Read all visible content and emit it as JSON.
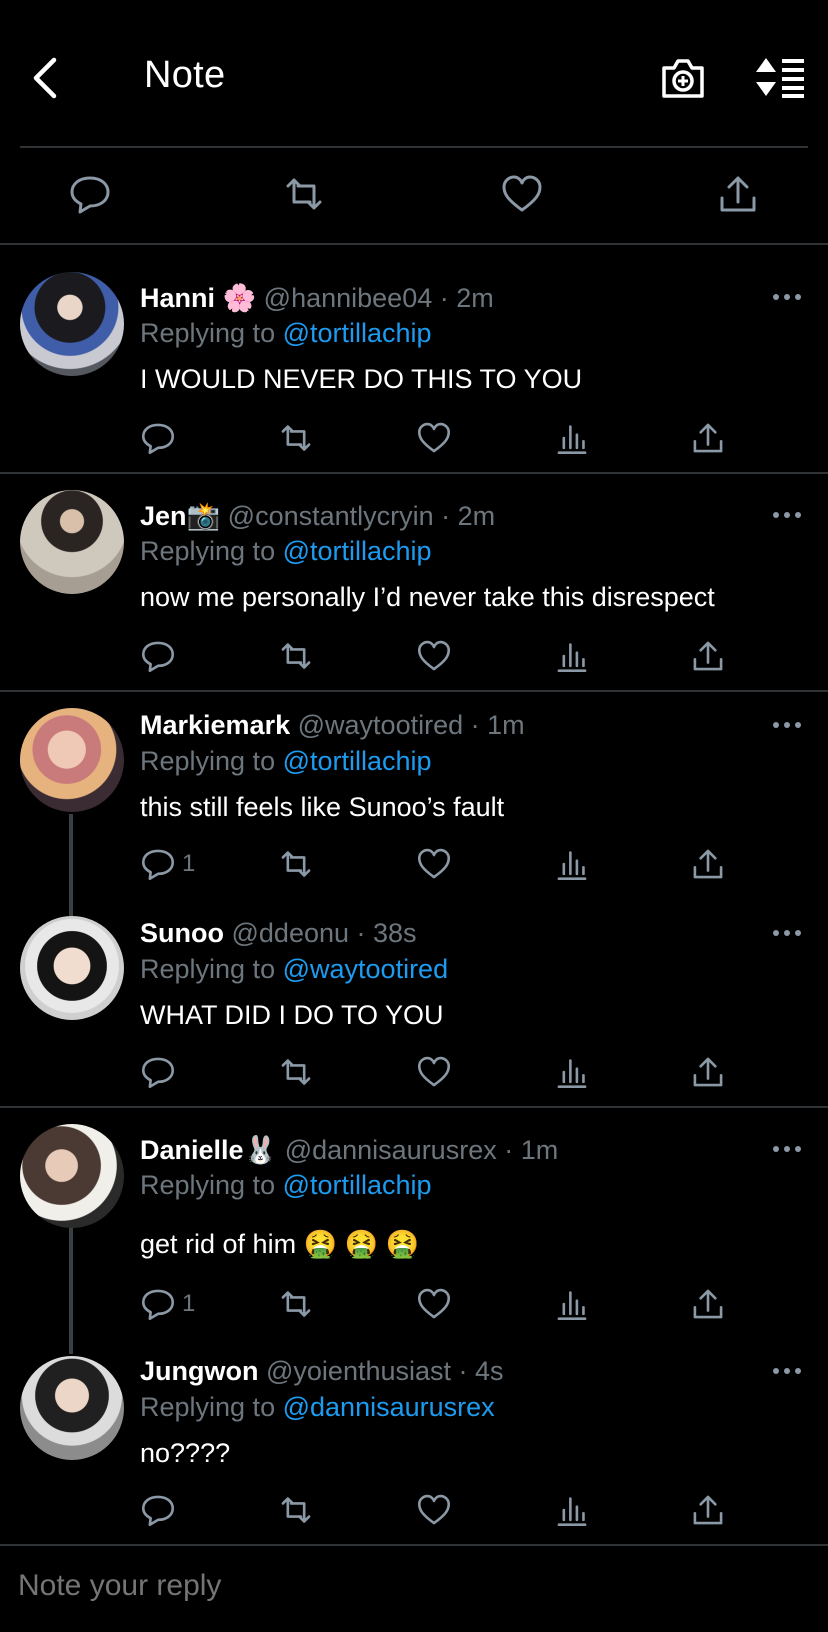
{
  "header": {
    "title": "Note",
    "back_icon": "chevron-left-icon",
    "camera_icon": "camera-plus-icon",
    "sort_icon": "sort-list-icon"
  },
  "action_bar": [
    "reply-icon",
    "retweet-icon",
    "like-icon",
    "share-icon"
  ],
  "colors": {
    "background": "#000000",
    "accent": "#1d9bf0",
    "muted": "#6e767d",
    "divider": "#2f3336"
  },
  "replying_label": "Replying to",
  "tweets": [
    {
      "name": "Hanni",
      "emoji": "🌸",
      "handle": "@hannibee04",
      "time": "· 2m",
      "replying_to": "@tortillachip",
      "text": "I WOULD NEVER DO THIS TO YOU",
      "reply_count": ""
    },
    {
      "name": "Jen",
      "emoji": "📸",
      "handle": "@constantlycryin",
      "time": "· 2m",
      "replying_to": "@tortillachip",
      "text": "now me personally I’d never take this disrespect",
      "reply_count": ""
    },
    {
      "name": "Markiemark",
      "emoji": "",
      "handle": "@waytootired",
      "time": "· 1m",
      "replying_to": "@tortillachip",
      "text": "this still feels like Sunoo’s fault",
      "reply_count": "1"
    },
    {
      "name": "Sunoo",
      "emoji": "",
      "handle": "@ddeonu",
      "time": "· 38s",
      "replying_to": "@waytootired",
      "text": "WHAT DID I DO TO YOU",
      "reply_count": ""
    },
    {
      "name": "Danielle",
      "emoji": "🐰",
      "handle": "@dannisaurusrex",
      "time": "· 1m",
      "replying_to": "@tortillachip",
      "text": "get rid of him 🤮 🤮 🤮",
      "reply_count": "1"
    },
    {
      "name": "Jungwon",
      "emoji": "",
      "handle": "@yoienthusiast",
      "time": "· 4s",
      "replying_to": "@dannisaurusrex",
      "text": "no????",
      "reply_count": ""
    }
  ],
  "composer": {
    "placeholder": "Note your reply"
  }
}
